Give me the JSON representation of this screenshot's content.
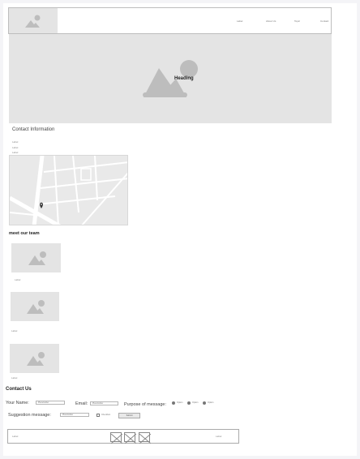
{
  "nav": {
    "items": [
      "Label",
      "About Us",
      "Topic",
      "Contact"
    ]
  },
  "hero": {
    "heading": "Heading"
  },
  "contact_info": {
    "title": "Contact Information",
    "lines": [
      "Label",
      "Label",
      "Label"
    ]
  },
  "team": {
    "title": "meet our team",
    "members": [
      "Label",
      "Label",
      "Label"
    ]
  },
  "contact_form": {
    "title": "Contact Us",
    "name_label": "Your Name:",
    "name_placeholder": "Placeholder",
    "email_label": "Email:",
    "email_placeholder": "Placeholder",
    "purpose_label": "Purpose of message:",
    "purpose_options": [
      "Option",
      "Option",
      "Option"
    ],
    "suggestion_label": "Suggestion message:",
    "suggestion_placeholder": "Placeholder",
    "checkbox_label": "Checkbox",
    "submit_label": "Submit"
  },
  "footer": {
    "left_label": "Label",
    "right_label": "Label"
  },
  "colors": {
    "placeholder_fill": "#e4e4e4",
    "placeholder_icon": "#bdbdbd",
    "map_marker": "#333333"
  }
}
